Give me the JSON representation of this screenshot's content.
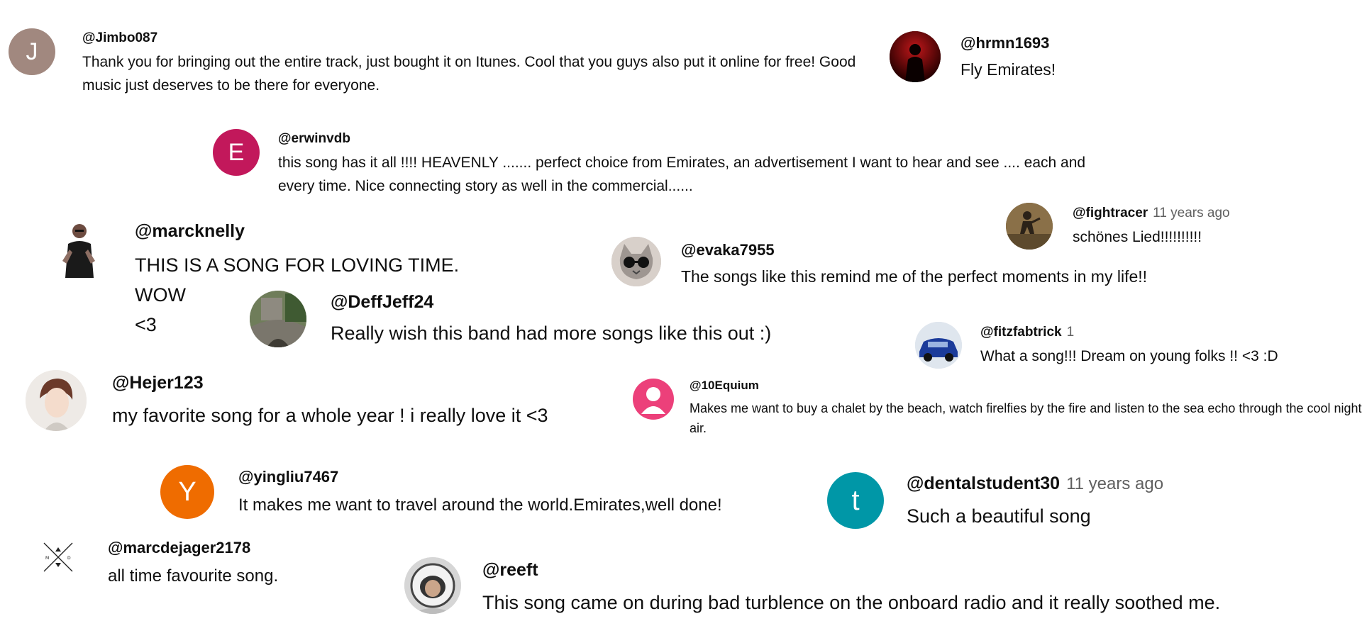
{
  "comments": [
    {
      "handle": "@Jimbo087",
      "avatar_letter": "J",
      "avatar_color": "#a1887f",
      "text": "Thank you for bringing out the entire track, just bought it on Itunes. Cool that you guys also put it online for free! Good music just deserves to be there for everyone."
    },
    {
      "handle": "@hrmn1693",
      "avatar_icon": "silhouette-red-icon",
      "text": "Fly Emirates!"
    },
    {
      "handle": "@erwinvdb",
      "avatar_letter": "E",
      "avatar_color": "#c2185b",
      "text": "this song has it all !!!!  HEAVENLY ....... perfect choice from Emirates, an advertisement I want to hear and see .... each and every time.  Nice connecting story as well in the commercial......"
    },
    {
      "handle": "@marcknelly",
      "avatar_icon": "person-photo-icon",
      "text_lines": [
        "THIS IS A SONG FOR LOVING TIME.",
        "WOW",
        "<3"
      ]
    },
    {
      "handle": "@evaka7955",
      "avatar_icon": "cat-sunglasses-icon",
      "text": "The songs like this remind me of the perfect moments in my life!!"
    },
    {
      "handle": "@fightracer",
      "time": "11 years ago",
      "avatar_icon": "runner-photo-icon",
      "text": "schönes Lied!!!!!!!!!!"
    },
    {
      "handle": "@DeffJeff24",
      "avatar_icon": "stone-bridge-photo-icon",
      "text": "Really wish this band had more songs like this out :)"
    },
    {
      "handle": "@fitzfabtrick",
      "time": "1",
      "avatar_icon": "blue-car-photo-icon",
      "text": "What a song!!! Dream on young folks !!  <3 :D"
    },
    {
      "handle": "@Hejer123",
      "avatar_icon": "anime-portrait-icon",
      "text": "my favorite song for a whole year ! i really love it <3"
    },
    {
      "handle": "@10Equium",
      "avatar_icon": "default-user-icon",
      "avatar_color": "#ec407a",
      "text": "Makes me want to buy a chalet by the beach, watch firelfies by the fire and listen to the sea echo through the cool night air."
    },
    {
      "handle": "@yingliu7467",
      "avatar_letter": "Y",
      "avatar_color": "#ef6c00",
      "text": "It makes me want to travel around the world.Emirates,well done!"
    },
    {
      "handle": "@dentalstudent30",
      "time": "11 years ago",
      "avatar_letter": "t",
      "avatar_color": "#0097a7",
      "text": "Such a beautiful song"
    },
    {
      "handle": "@marcdejager2178",
      "avatar_icon": "crossed-lines-logo-icon",
      "avatar_logo_letters": [
        "M",
        "D"
      ],
      "text": "all time favourite song."
    },
    {
      "handle": "@reeft",
      "avatar_icon": "astronaut-photo-icon",
      "text": "This song came on during bad turblence on the onboard radio and it really soothed me."
    }
  ]
}
